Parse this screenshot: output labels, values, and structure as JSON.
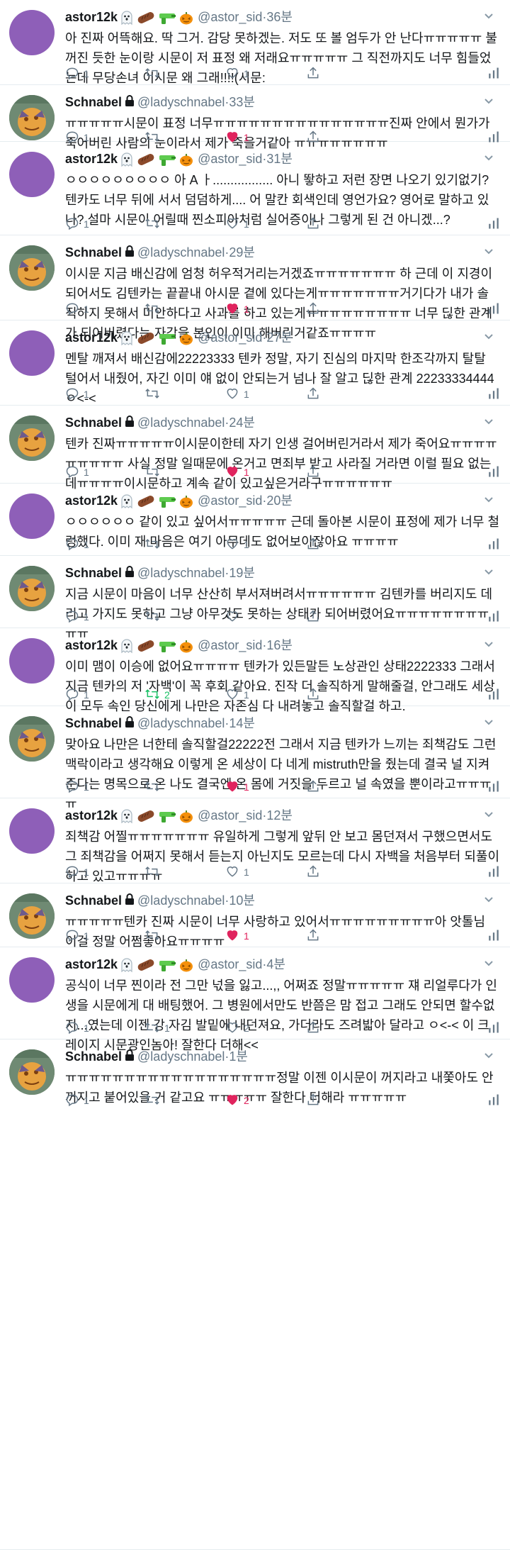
{
  "users": {
    "astor": {
      "name": "astor12k",
      "handle": "@astor_sid"
    },
    "schnabel": {
      "name": "Schnabel",
      "handle": "@ladyschnabel"
    }
  },
  "dot": "·",
  "colors": {
    "like_active": "#e0245e",
    "retweet_active": "#17bf63",
    "icon": "#657786",
    "avatar_purple": "#8e5fb8"
  },
  "tweets": [
    {
      "time": "36분",
      "text": "아 진짜 어뜩해요. 딱 그거. 감당 못하겠는. 저도 또 볼 엄두가 안 난다ㅠㅠㅠㅠㅠ 불꺼진 듯한 눈이랑 시문이 저 표정 왜 저래요ㅠㅠㅠㅠㅠ 그 직전까지도 너무 힘들었는데 무당손녀 이시문 왜 그래!!!!(시문:",
      "replies": "1",
      "retweets": "",
      "likes": "1"
    },
    {
      "time": "33분",
      "text": "ㅠㅠㅠㅠㅠ시문이 표정 너무ㅠㅠㅠㅠㅠㅠㅠㅠㅠㅠㅠㅠㅠㅠㅠ진짜 안에서 뭔가가 죽어버린 사람의 눈이라서 제가 죽을거같아 ㅠㅠㅠㅠㅠㅠㅠㅠ",
      "replies": "1",
      "retweets": "",
      "likes": "1"
    },
    {
      "time": "31분",
      "text": "ㅇㅇㅇㅇㅇㅇㅇㅇㅇ 아 A ㅏ................. 아니 뙇하고 저런 장면 나오기 있기없기? 텐카도 너무 뒤에 서서 덤덤하게.... 어 말칸 회색인데 영언가요? 영어로 말하고 있나? 설마 시문이 어릴때 찐소피아처럼 실어증이나 그렇게 된 건 아니겠...?",
      "replies": "1",
      "retweets": "",
      "likes": "1"
    },
    {
      "time": "29분",
      "text": "이시문 지금 배신감에 엄청 허우적거리는거겠죠ㅠㅠㅠㅠㅠㅠㅠ 하 근데 이 지경이 되어서도 김텐카는 끝끝내 아시문 곁에 있다는게ㅠㅠㅠㅠㅠㅠㅠ거기다가 내가 솔직하지 못해서 미안하다고 사과를 하고 있는게ㅠㅠㅠㅠㅠㅠㅠㅠㅠ 너무 딚한 관계가 되어버렸다는 자각을 본인이 이미 해버린거같죠ㅠㅠㅠㅠ",
      "replies": "1",
      "retweets": "",
      "likes": "1"
    },
    {
      "time": "27분",
      "text": "멘탈 깨져서 배신감에22223333 텐카 정말, 자기 진심의 마지막 한조각까지 탈탈 털어서 내줬어, 자긴 이미 얘 없이 안되는거 넘나 잘 알고 딚한 관계 22233334444 ㅇ<-<",
      "replies": "1",
      "retweets": "",
      "likes": "1"
    },
    {
      "time": "24분",
      "text": "텐카 진짜ㅠㅠㅠㅠㅠ이시문이한테 자기 인생 걸어버린거라서 제가 죽어요ㅠㅠㅠㅠㅠㅠㅠㅠㅠ 사실 정말 일때문에 온거고 면죄부 받고 사라질 거라면 이럴 필요 없는데ㅠㅠㅠㅠ이시문하고 계속 같이 있고싶은거라구ㅠㅠㅠㅠㅠㅠ",
      "replies": "1",
      "retweets": "",
      "likes": "1"
    },
    {
      "time": "20분",
      "text": "ㅇㅇㅇㅇㅇㅇ 같이 있고 싶어서ㅠㅠㅠㅠㅠ 근데 돌아본 시문이 표정에 제가 너무 철렁했다. 이미 재 마음은 여기 아무데도 없어보이잖아요 ㅠㅠㅠㅠ",
      "replies": "1",
      "retweets": "",
      "likes": "1"
    },
    {
      "time": "19분",
      "text": "지금 시문이 마음이 너무 산산히 부서져버려서ㅠㅠㅠㅠㅠㅠ 김텐카를 버리지도 데리고 가지도 못하고 그냥 아무것도 못하는 상태가 되어버렸어요ㅠㅠㅠㅠㅠㅠㅠㅠㅠㅠ",
      "replies": "1",
      "retweets": "",
      "likes": ""
    },
    {
      "time": "16분",
      "text": "이미 맴이 이승에 없어요ㅠㅠㅠㅠ 텐카가 있든말든 노상관인 상태2222333 그래서 지금 텐카의 저 '자백'이 꼭 후회 같아요. 진작 더 솔직하게 말해줄걸, 안그래도 세상이 모두 속인 당신에게 나만은 자존심 다 내려놓고 솔직할걸 하고.",
      "replies": "1",
      "retweets": "2",
      "likes": "1"
    },
    {
      "time": "14분",
      "text": "맞아요 나만은 너한테 솔직할걸22222전 그래서 지금 텐카가 느끼는 죄책감도 그런 맥락이라고 생각해요 이렇게 온 세상이 다 네게 mistruth만을 줬는데 결국 널 지켜준다는 명목으로 온 나도 결국엔 온 몸에 거짓을 두르고 널 속였을 뿐이라고ㅠㅠㅠㅠ",
      "replies": "1",
      "retweets": "",
      "likes": "1"
    },
    {
      "time": "12분",
      "text": "죄책감 어찔ㅠㅠㅠㅠㅠㅠㅠ 유일하게 그렇게 앞뒤 안 보고 몸던져서 구했으면서도 그 죄책감을 어쩌지 못해서 듣는지 아닌지도 모르는데 다시 자백을 처음부터 되풀이하고 있고ㅠㅠㅠㅠ",
      "replies": "1",
      "retweets": "",
      "likes": "1"
    },
    {
      "time": "10분",
      "text": "ㅠㅠㅠㅠㅠ텐카 진짜 시문이 너무 사랑하고 있어서ㅠㅠㅠㅠㅠㅠㅠㅠㅠ아 앗톨님 이걸 정말 어쩜좋아요ㅠㅠㅠㅠ",
      "replies": "1",
      "retweets": "",
      "likes": "1"
    },
    {
      "time": "4분",
      "text": "공식이 너무 찐이라 전 그만 넋을 잃고...,, 어쩌죠 정말ㅠㅠㅠㅠㅠ 쟤 리얼루다가 인생을 시문에게 대 배팅했어. 그 병원에서만도 반쯤은 맘 접고 그래도 안되면 할수없지...였는데 이젠 강 자김 발밑에 내던져요, 가더라도 즈려밟아 달라고 ㅇ<-< 이 크레이지 시문광인놈아! 잘한다 더해<<",
      "replies": "1",
      "retweets": "1",
      "likes": "2"
    },
    {
      "time": "1분",
      "text": "ㅠㅠㅠㅠㅠㅠㅠㅠㅠㅠㅠㅠㅠㅠㅠㅠㅠㅠ정말 이젠 이시문이 꺼지라고 내쫓아도 안 꺼지고 붙어있을 거 같고요 ㅠㅠㅠㅠㅠ 잘한다 더해라 ㅠㅠㅠㅠㅠ",
      "replies": "1",
      "retweets": "",
      "likes": "2"
    }
  ]
}
